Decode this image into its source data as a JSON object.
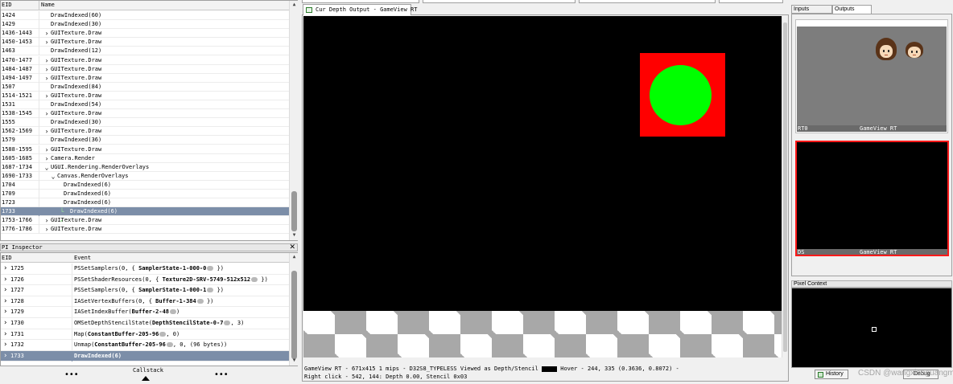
{
  "event_browser": {
    "header": {
      "eid": "EID",
      "name": "Name"
    },
    "rows": [
      {
        "eid": "1424",
        "name": "DrawIndexed(60)",
        "indent": 1,
        "arrow": false,
        "selected": false
      },
      {
        "eid": "1429",
        "name": "DrawIndexed(30)",
        "indent": 1,
        "arrow": false,
        "selected": false
      },
      {
        "eid": "1436-1443",
        "name": "GUITexture.Draw",
        "indent": 1,
        "arrow": true,
        "arrow_dir": "right",
        "selected": false
      },
      {
        "eid": "1450-1453",
        "name": "GUITexture.Draw",
        "indent": 1,
        "arrow": true,
        "arrow_dir": "right",
        "selected": false
      },
      {
        "eid": "1463",
        "name": "DrawIndexed(12)",
        "indent": 1,
        "arrow": false,
        "selected": false
      },
      {
        "eid": "1470-1477",
        "name": "GUITexture.Draw",
        "indent": 1,
        "arrow": true,
        "arrow_dir": "right",
        "selected": false
      },
      {
        "eid": "1484-1487",
        "name": "GUITexture.Draw",
        "indent": 1,
        "arrow": true,
        "arrow_dir": "right",
        "selected": false
      },
      {
        "eid": "1494-1497",
        "name": "GUITexture.Draw",
        "indent": 1,
        "arrow": true,
        "arrow_dir": "right",
        "selected": false
      },
      {
        "eid": "1507",
        "name": "DrawIndexed(84)",
        "indent": 1,
        "arrow": false,
        "selected": false
      },
      {
        "eid": "1514-1521",
        "name": "GUITexture.Draw",
        "indent": 1,
        "arrow": true,
        "arrow_dir": "right",
        "selected": false
      },
      {
        "eid": "1531",
        "name": "DrawIndexed(54)",
        "indent": 1,
        "arrow": false,
        "selected": false
      },
      {
        "eid": "1538-1545",
        "name": "GUITexture.Draw",
        "indent": 1,
        "arrow": true,
        "arrow_dir": "right",
        "selected": false
      },
      {
        "eid": "1555",
        "name": "DrawIndexed(30)",
        "indent": 1,
        "arrow": false,
        "selected": false
      },
      {
        "eid": "1562-1569",
        "name": "GUITexture.Draw",
        "indent": 1,
        "arrow": true,
        "arrow_dir": "right",
        "selected": false
      },
      {
        "eid": "1579",
        "name": "DrawIndexed(36)",
        "indent": 1,
        "arrow": false,
        "selected": false
      },
      {
        "eid": "1588-1595",
        "name": "GUITexture.Draw",
        "indent": 1,
        "arrow": true,
        "arrow_dir": "right",
        "selected": false
      },
      {
        "eid": "1605-1685",
        "name": "Camera.Render",
        "indent": 1,
        "arrow": true,
        "arrow_dir": "right",
        "selected": false
      },
      {
        "eid": "1687-1734",
        "name": "UGUI.Rendering.RenderOverlays",
        "indent": 1,
        "arrow": true,
        "arrow_dir": "down",
        "selected": false
      },
      {
        "eid": "1690-1733",
        "name": "Canvas.RenderOverlays",
        "indent": 2,
        "arrow": true,
        "arrow_dir": "down",
        "selected": false
      },
      {
        "eid": "1704",
        "name": "DrawIndexed(6)",
        "indent": 3,
        "arrow": false,
        "selected": false
      },
      {
        "eid": "1709",
        "name": "DrawIndexed(6)",
        "indent": 3,
        "arrow": false,
        "selected": false
      },
      {
        "eid": "1723",
        "name": "DrawIndexed(6)",
        "indent": 3,
        "arrow": false,
        "selected": false
      },
      {
        "eid": "1733",
        "name": "DrawIndexed(6)",
        "indent": 4,
        "arrow": false,
        "selected": true
      },
      {
        "eid": "1753-1766",
        "name": "GUITexture.Draw",
        "indent": 1,
        "arrow": true,
        "arrow_dir": "right",
        "selected": false
      },
      {
        "eid": "1776-1786",
        "name": "GUITexture.Draw",
        "indent": 1,
        "arrow": true,
        "arrow_dir": "right",
        "selected": false
      }
    ]
  },
  "api_inspector": {
    "title": "PI Inspector",
    "close_glyph": "✕",
    "header": {
      "eid": "EID",
      "event": "Event"
    },
    "rows": [
      {
        "eid": "1725",
        "pre": "PSSetSamplers(0,  {  ",
        "bold": "SamplerState-1-000-0",
        "post": "  })",
        "link": true,
        "selected": false
      },
      {
        "eid": "1726",
        "pre": "PSSetShaderResources(0,  {  ",
        "bold": "Texture2D-SRV-5749-512x512",
        "post": "  })",
        "link": true,
        "selected": false
      },
      {
        "eid": "1727",
        "pre": "PSSetSamplers(0,  {  ",
        "bold": "SamplerState-1-000-1",
        "post": "  })",
        "link": true,
        "selected": false
      },
      {
        "eid": "1728",
        "pre": "IASetVertexBuffers(0,  {  ",
        "bold": "Buffer-1-384",
        "post": "  })",
        "link": true,
        "selected": false
      },
      {
        "eid": "1729",
        "pre": "IASetIndexBuffer(",
        "bold": "Buffer-2-48",
        "post": ")",
        "link": true,
        "selected": false
      },
      {
        "eid": "1730",
        "pre": "OMSetDepthStencilState(",
        "bold": "DepthStencilState-0-7",
        "post": ",  3)",
        "link": true,
        "selected": false
      },
      {
        "eid": "1731",
        "pre": "Map(",
        "bold": "ConstantBuffer-205-96",
        "post": ",  0)",
        "link": true,
        "selected": false
      },
      {
        "eid": "1732",
        "pre": "Unmap(",
        "bold": "ConstantBuffer-205-96",
        "post": ",  0,  (96  bytes))",
        "link": true,
        "selected": false
      },
      {
        "eid": "1733",
        "pre": "",
        "bold": "DrawIndexed(6)",
        "post": "",
        "link": false,
        "selected": true
      }
    ]
  },
  "bottom_tabs": {
    "left_dots": "•••",
    "callstack": "Callstack",
    "right_dots": "•••"
  },
  "texture_viewer": {
    "tab_label": "Cur Depth Output - GameView RT",
    "status_line1_pre": "GameView RT -  671x415 1 mips -  D32S8_TYPELESS Viewed as Depth/Stencil",
    "status_line1_post": "Hover -   244,  335 (0.3636, 0.8072)  -",
    "status_line2": "Right click -  542,  144: Depth 0.00, Stencil 0x03"
  },
  "thumbnails": {
    "tabs": [
      {
        "label": "Inputs",
        "active": false
      },
      {
        "label": "Outputs",
        "active": true
      }
    ],
    "items": [
      {
        "slot": "RT0",
        "name": "GameView RT"
      },
      {
        "slot": "DS",
        "name": "GameView RT"
      }
    ]
  },
  "pixel_context": {
    "title": "Pixel Context",
    "history_label": "History",
    "debug_label": "Debug"
  },
  "watermark": "CSDN @wangxiaoguangm",
  "colors": {
    "selection": "#7c8ea8",
    "render_bg": "#000000",
    "square": "#ff0000",
    "circle": "#00ff00",
    "ds_highlight": "#ff1a1a"
  }
}
